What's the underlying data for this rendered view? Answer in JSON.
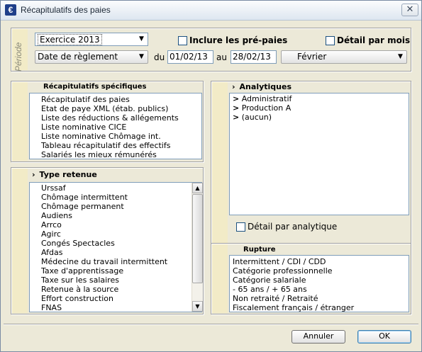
{
  "window": {
    "title": "Récapitulatifs des paies"
  },
  "periode": {
    "label": "Période",
    "exercice": "Exercice 2013",
    "date_type": "Date de règlement",
    "du_label": "du",
    "au_label": "au",
    "date_from": "01/02/13",
    "date_to": "28/02/13",
    "month": "Février",
    "inclure_label": "Inclure les pré-paies",
    "detail_mois_label": "Détail par mois"
  },
  "recap": {
    "title": "Récapitulatifs spécifiques",
    "items": [
      "Récapitulatif des paies",
      "Etat de paye XML (étab. publics)",
      "Liste des réductions & allégements",
      "Liste nominative CICE",
      "Liste nominative Chômage int.",
      "Tableau récapitulatif des effectifs",
      "Salariés les mieux rémunérés"
    ]
  },
  "type_retenue": {
    "title": "Type retenue",
    "items": [
      "Urssaf",
      "Chômage intermittent",
      "Chômage permanent",
      "Audiens",
      "Arrco",
      "Agirc",
      "Congés Spectacles",
      "Afdas",
      "Médecine du travail intermittent",
      "Taxe d'apprentissage",
      "Taxe sur les salaires",
      "Retenue à la source",
      "Effort construction",
      "FNAS"
    ]
  },
  "analytiques": {
    "title": "Analytiques",
    "items": [
      "Administratif",
      "Production A",
      "(aucun)"
    ],
    "detail_label": "Détail par analytique"
  },
  "rupture": {
    "title": "Rupture",
    "items": [
      "Intermittent / CDI / CDD",
      "Catégorie professionnelle",
      "Catégorie salariale",
      "- 65 ans / + 65 ans",
      "Non retraité / Retraité",
      "Fiscalement français / étranger"
    ]
  },
  "buttons": {
    "cancel": "Annuler",
    "ok": "OK"
  },
  "icons": {
    "app": "app-icon",
    "close": "close-icon",
    "expand": "expand-arrow-icon",
    "dropdown": "dropdown-arrow-icon"
  }
}
